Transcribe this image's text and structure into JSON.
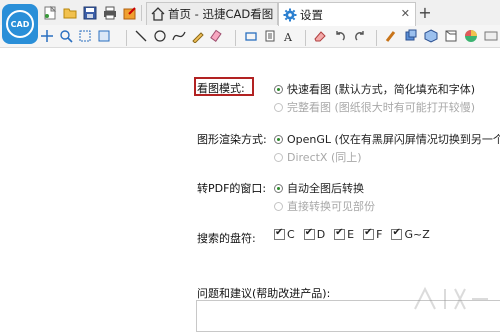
{
  "app": {
    "logo_text": "CAD",
    "brand_color": "#2a8fd8"
  },
  "tabs": [
    {
      "label": "首页 - 迅捷CAD看图",
      "icon": "home-icon"
    },
    {
      "label": "设置",
      "icon": "gear-icon",
      "active": true
    }
  ],
  "settings": {
    "view_mode": {
      "label": "看图模式:",
      "options": [
        {
          "label": "快速看图 (默认方式，简化填充和字体)",
          "selected": true,
          "enabled": true
        },
        {
          "label": "完整看图 (图纸很大时有可能打开较慢)",
          "selected": false,
          "enabled": false
        }
      ]
    },
    "render_mode": {
      "label": "图形渲染方式:",
      "options": [
        {
          "label": "OpenGL (仅在有黑屏闪屏情况切换到另一个",
          "selected": true,
          "enabled": true
        },
        {
          "label": "DirectX (同上)",
          "selected": false,
          "enabled": false
        }
      ]
    },
    "pdf_window": {
      "label": "转PDF的窗口:",
      "options": [
        {
          "label": "自动全图后转换",
          "selected": true,
          "enabled": true
        },
        {
          "label": "直接转换可见部份",
          "selected": false,
          "enabled": false
        }
      ]
    },
    "search_drives": {
      "label": "搜索的盘符:",
      "drives": [
        "C",
        "D",
        "E",
        "F",
        "G~Z"
      ]
    },
    "feedback": {
      "label": "问题和建议(帮助改进产品):"
    }
  },
  "highlight_color": "#b22222"
}
